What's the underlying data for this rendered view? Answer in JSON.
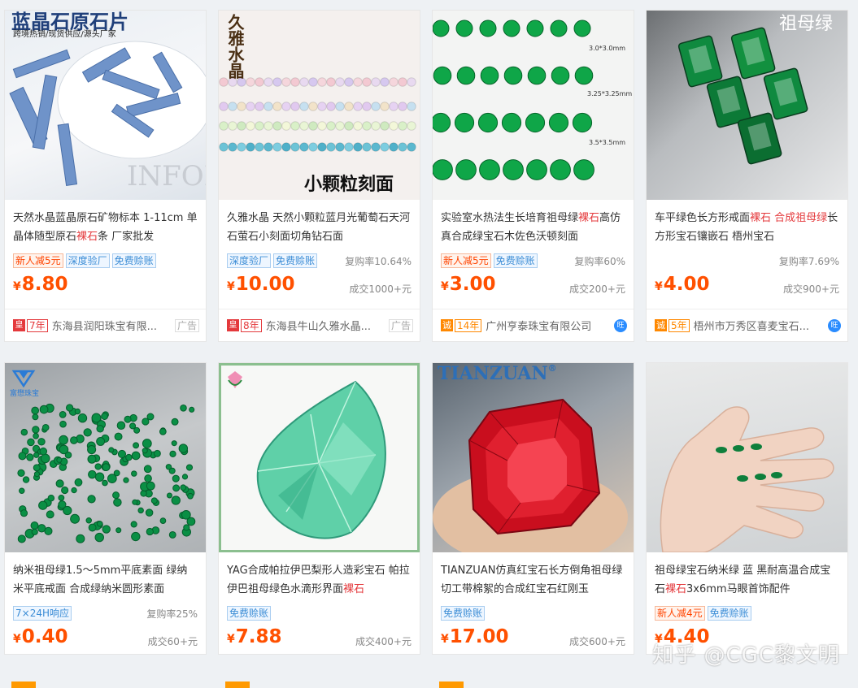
{
  "watermark": "知乎 @CGC黎文明",
  "products": [
    {
      "img_label": "蓝晶石原石片",
      "img_sub": "跨境热销/现货供应/源头厂家",
      "title_pre": "天然水晶蓝晶原石矿物标本 1-11cm 单晶体随型原石",
      "title_hl": "裸石",
      "title_post": "条 厂家批发",
      "tags": [
        {
          "text": "新人减5元",
          "type": "orange"
        },
        {
          "text": "深度验厂",
          "type": "blue"
        },
        {
          "text": "免费赊账",
          "type": "blue"
        }
      ],
      "repeat": "",
      "price": "8.80",
      "sold": "",
      "shop_years": "7年",
      "shop_badge": "皇",
      "shop": "东海县润阳珠宝有限...",
      "shop_end": "广告"
    },
    {
      "img_label": "小颗粒刻面",
      "img_sub": "久雅水晶",
      "title_pre": "久雅水晶 天然小颗粒蓝月光葡萄石天河石萤石小刻面切角钻石面",
      "title_hl": "",
      "title_post": "",
      "tags": [
        {
          "text": "深度验厂",
          "type": "blue"
        },
        {
          "text": "免费赊账",
          "type": "blue"
        }
      ],
      "repeat": "复购率10.64%",
      "price": "10.00",
      "sold": "成交1000+元",
      "shop_years": "8年",
      "shop_badge": "皇",
      "shop": "东海县牛山久雅水晶...",
      "shop_end": "广告"
    },
    {
      "img_label": "3.0*3.0mm",
      "img_sub": "3.25*3.25mm",
      "img_sub2": "3.5*3.5mm",
      "title_pre": "实验室水热法生长培育祖母绿",
      "title_hl": "裸石",
      "title_post": "高仿真合成绿宝石木佐色沃顿刻面",
      "tags": [
        {
          "text": "新人减5元",
          "type": "orange"
        },
        {
          "text": "免费赊账",
          "type": "blue"
        }
      ],
      "repeat": "复购率60%",
      "price": "3.00",
      "sold": "成交200+元",
      "shop_years": "14年",
      "shop_badge": "诚",
      "shop": "广州亨泰珠宝有限公司",
      "shop_end": "旺"
    },
    {
      "img_label": "祖母绿",
      "title_pre": "车平绿色长方形戒面",
      "title_hl": "裸石 合成祖母绿",
      "title_post": "长方形宝石镶嵌石 梧州宝石",
      "tags": [],
      "repeat": "复购率7.69%",
      "price": "4.00",
      "sold": "成交900+元",
      "shop_years": "5年",
      "shop_badge": "诚",
      "shop": "梧州市万秀区喜麦宝石...",
      "shop_end": "旺"
    },
    {
      "img_label": "富懋珠宝",
      "title_pre": "纳米祖母绿1.5～5mm平底素面 绿纳米平底戒面 合成绿纳米圆形素面",
      "title_hl": "",
      "title_post": "",
      "tags": [
        {
          "text": "7×24H响应",
          "type": "blue"
        }
      ],
      "repeat": "复购率25%",
      "price": "0.40",
      "sold": "成交60+元"
    },
    {
      "img_label": "",
      "title_pre": "YAG合成帕拉伊巴梨形人造彩宝石 帕拉伊巴祖母绿色水滴形界面",
      "title_hl": "裸石",
      "title_post": "",
      "tags": [
        {
          "text": "免费赊账",
          "type": "blue"
        }
      ],
      "repeat": "",
      "price": "7.88",
      "sold": "成交400+元"
    },
    {
      "img_label": "TIANZUAN",
      "img_reg": "®",
      "title_pre": "TIANZUAN仿真红宝石长方倒角祖母绿切工带棉絮的合成红宝石红刚玉",
      "title_hl": "",
      "title_post": "",
      "tags": [
        {
          "text": "免费赊账",
          "type": "blue"
        }
      ],
      "repeat": "",
      "price": "17.00",
      "sold": "成交600+元"
    },
    {
      "img_label": "",
      "title_pre": "祖母绿宝石纳米绿 蓝 黑耐高温合成宝石",
      "title_hl": "裸石",
      "title_post": "3x6mm马眼首饰配件",
      "tags": [
        {
          "text": "新人减4元",
          "type": "orange"
        },
        {
          "text": "免费赊账",
          "type": "blue"
        }
      ],
      "repeat": "",
      "price": "4.40",
      "sold": ""
    }
  ],
  "currency": "¥"
}
